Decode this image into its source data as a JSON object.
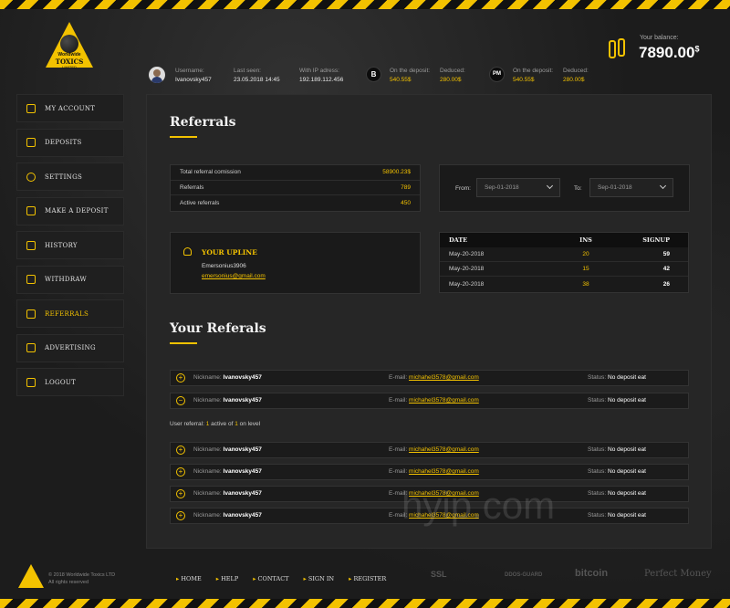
{
  "brand": {
    "line1": "Worldwide",
    "line2": "TOXICS",
    "line3": "LIMITED"
  },
  "user": {
    "username_label": "Username:",
    "username": "Ivanovsky457",
    "lastseen_label": "Last seen:",
    "lastseen": "23.05.2018  14:45",
    "ip_label": "With IP adress:",
    "ip": "192.189.112.456"
  },
  "deposits_bar": [
    {
      "icon": "B",
      "on_label": "On the deposit:",
      "on_value": "540.55$",
      "ded_label": "Deduced:",
      "ded_value": "280.00$"
    },
    {
      "icon": "PM",
      "on_label": "On the deposit:",
      "on_value": "540.55$",
      "ded_label": "Deduced:",
      "ded_value": "280.00$"
    }
  ],
  "balance": {
    "label": "Your balance:",
    "value": "7890.00",
    "currency": "$"
  },
  "sidebar": [
    {
      "label": "MY ACCOUNT",
      "icon": "account-icon"
    },
    {
      "label": "DEPOSITS",
      "icon": "deposits-icon"
    },
    {
      "label": "SETTINGS",
      "icon": "gear-icon"
    },
    {
      "label": "MAKE A DEPOSIT",
      "icon": "deposit-icon"
    },
    {
      "label": "HISTORY",
      "icon": "calendar-icon"
    },
    {
      "label": "WITHDRAW",
      "icon": "withdraw-icon"
    },
    {
      "label": "REFERRALS",
      "icon": "referrals-icon"
    },
    {
      "label": "ADVERTISING",
      "icon": "megaphone-icon"
    },
    {
      "label": "LOGOUT",
      "icon": "logout-icon"
    }
  ],
  "referrals": {
    "title": "Referrals",
    "stats": [
      {
        "label": "Total referral comission",
        "value": "58900.23$"
      },
      {
        "label": "Referrals",
        "value": "789"
      },
      {
        "label": "Active referrals",
        "value": "450"
      }
    ],
    "date_filter": {
      "from_label": "From:",
      "from_value": "Sep-01-2018",
      "to_label": "To:",
      "to_value": "Sep-01-2018"
    },
    "upline": {
      "title": "YOUR UPLINE",
      "name": "Emersonius3906",
      "email": "emersonius@gmail.com"
    },
    "table": {
      "headers": [
        "DATE",
        "INS",
        "SIGNUP"
      ],
      "rows": [
        [
          "May-20-2018",
          "20",
          "59"
        ],
        [
          "May-20-2018",
          "15",
          "42"
        ],
        [
          "May-20-2018",
          "38",
          "26"
        ]
      ]
    }
  },
  "your_referrals": {
    "title": "Your Referals",
    "nick_label": "Nickname:",
    "mail_label": "E-mail:",
    "status_label": "Status:",
    "level_text": {
      "pre": "User referral: ",
      "n1": "1",
      "mid": " active of ",
      "n2": "1",
      "post": " on level"
    },
    "items": [
      {
        "sign": "+",
        "nick": "Ivanovsky457",
        "email": "michahel3578@gmail.com",
        "status": "No deposit eat"
      },
      {
        "sign": "−",
        "nick": "Ivanovsky457",
        "email": "michahel3578@gmail.com",
        "status": "No deposit eat"
      },
      {
        "sign": "+",
        "nick": "Ivanovsky457",
        "email": "michahel3578@gmail.com",
        "status": "No deposit eat"
      },
      {
        "sign": "+",
        "nick": "Ivanovsky457",
        "email": "michahel3578@gmail.com",
        "status": "No deposit eat"
      },
      {
        "sign": "+",
        "nick": "Ivanovsky457",
        "email": "michahel3578@gmail.com",
        "status": "No deposit eat"
      },
      {
        "sign": "+",
        "nick": "Ivanovsky457",
        "email": "michahel3578@gmail.com",
        "status": "No deposit eat"
      }
    ]
  },
  "footer": {
    "copy1": "© 2018 Worldwide Toxics LTD",
    "copy2": "All rights reserved",
    "nav": [
      "HOME",
      "HELP",
      "CONTACT",
      "SIGN IN",
      "REGISTER"
    ],
    "badges": [
      "SSL",
      "DDOS-GUARD",
      "bitcoin",
      "Perfect Money"
    ]
  },
  "watermark": "hyip.com"
}
